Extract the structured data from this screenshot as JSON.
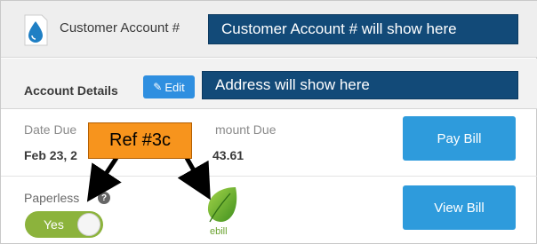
{
  "header": {
    "account_label": "Customer Account #",
    "account_annotation": "Customer Account # will show here"
  },
  "details": {
    "label": "Account Details",
    "edit_label": "Edit",
    "address_annotation": "Address will show here"
  },
  "billing": {
    "date_due_label": "Date Due",
    "date_due_value": "Feb 23, 2",
    "amount_due_label": "mount Due",
    "amount_due_value": "43.61",
    "pay_button": "Pay Bill"
  },
  "paperless": {
    "label": "Paperless",
    "help_icon": "?",
    "toggle_value": "Yes",
    "ebill_label": "ebill",
    "view_button": "View Bill"
  },
  "annotation": {
    "ref_label": "Ref #3c"
  },
  "colors": {
    "annotation_blue": "#124a78",
    "button_blue": "#2e9bdc",
    "edit_blue": "#2f8fe0",
    "toggle_green": "#8cb33c",
    "ref_orange": "#f7941d"
  },
  "icons": [
    "water-drop-icon",
    "pencil-icon",
    "question-icon",
    "leaf-icon"
  ]
}
